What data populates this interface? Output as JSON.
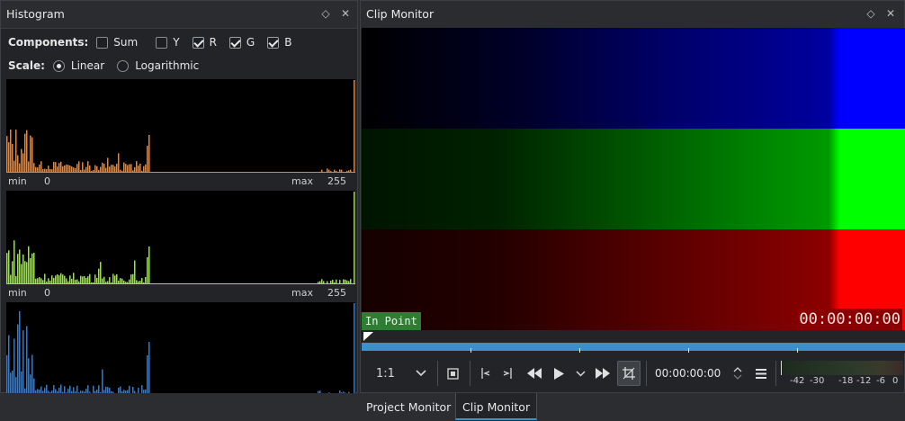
{
  "histogram": {
    "title": "Histogram",
    "components_label": "Components:",
    "components": [
      {
        "label": "Sum",
        "checked": false
      },
      {
        "label": "Y",
        "checked": false
      },
      {
        "label": "R",
        "checked": true
      },
      {
        "label": "G",
        "checked": true
      },
      {
        "label": "B",
        "checked": true
      }
    ],
    "scale_label": "Scale:",
    "scale_options": [
      {
        "label": "Linear",
        "selected": true
      },
      {
        "label": "Logarithmic",
        "selected": false
      }
    ],
    "axis": {
      "min": "min",
      "zero": "0",
      "max": "max",
      "top": "255"
    },
    "channels": [
      {
        "name": "red",
        "color": "#ff7f1a"
      },
      {
        "name": "green",
        "color": "#8fef1f"
      },
      {
        "name": "blue",
        "color": "#1f7fef"
      }
    ]
  },
  "clip_monitor": {
    "title": "Clip Monitor",
    "in_point_label": "In Point",
    "timecode_overlay": "00:00:00:00",
    "zoom_label": "1:1",
    "timecode_field": "00:00:00:00",
    "meter_labels": [
      "-42",
      "-30",
      "-18",
      "-12",
      "-6",
      "0"
    ]
  },
  "tabs": [
    {
      "label": "Project Monitor",
      "active": false
    },
    {
      "label": "Clip Monitor",
      "active": true
    }
  ],
  "icons": {
    "float": "◇",
    "close": "✕",
    "chevron": "⌵"
  }
}
